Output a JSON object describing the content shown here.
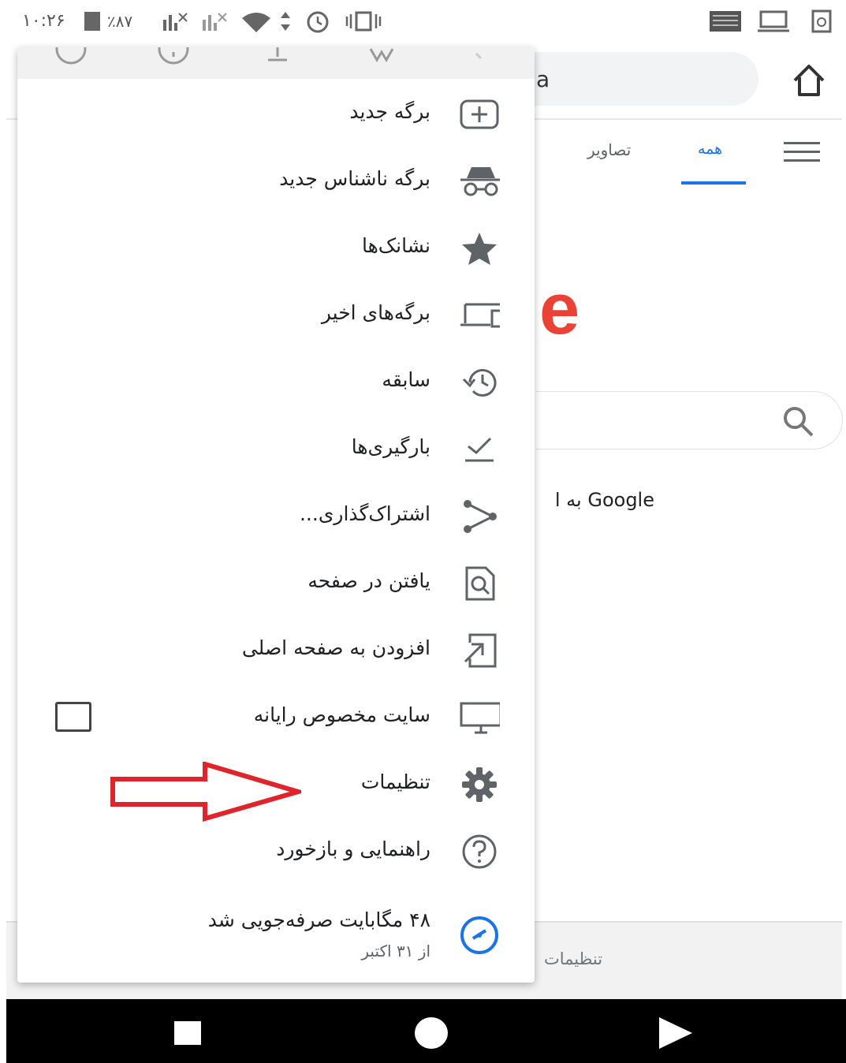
{
  "status_bar": {
    "time": "۱۰:۲۶",
    "battery": "٪۸۷"
  },
  "browser": {
    "omnibox_text": "a"
  },
  "google_page": {
    "tab_all": "همه",
    "tab_images": "تصاویر",
    "logo_partial": "e",
    "offered_text": "Google به ا",
    "footer_settings": "تنظیمات"
  },
  "menu": {
    "items": [
      {
        "label": "برگه جدید",
        "icon": "plus-box-icon"
      },
      {
        "label": "برگه ناشناس جدید",
        "icon": "incognito-icon"
      },
      {
        "label": "نشانک‌ها",
        "icon": "star-icon"
      },
      {
        "label": "برگه‌های اخیر",
        "icon": "devices-icon"
      },
      {
        "label": "سابقه",
        "icon": "history-icon"
      },
      {
        "label": "بارگیری‌ها",
        "icon": "download-check-icon"
      },
      {
        "label": "اشتراک‌گذاری...",
        "icon": "share-icon"
      },
      {
        "label": "یافتن در صفحه",
        "icon": "find-in-page-icon"
      },
      {
        "label": "افزودن به صفحه اصلی",
        "icon": "add-to-home-icon"
      },
      {
        "label": "سایت مخصوص رایانه",
        "icon": "desktop-icon",
        "checked": false
      },
      {
        "label": "تنظیمات",
        "icon": "gear-icon"
      },
      {
        "label": "راهنمایی و بازخورد",
        "icon": "help-icon"
      },
      {
        "label": "۴۸ مگابایت صرفه‌جویی شد",
        "sublabel": "از ۳۱ اکتبر",
        "icon": "data-saver-icon"
      }
    ]
  },
  "colors": {
    "accent_blue": "#1a73e8",
    "arrow_red": "#e0242b",
    "google_red": "#ea4335"
  }
}
